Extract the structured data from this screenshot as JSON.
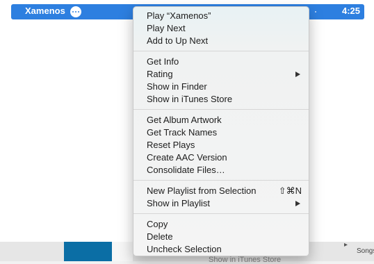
{
  "track": {
    "title": "Xamenos",
    "duration": "4:25"
  },
  "bottom": {
    "songs_label": "Songs",
    "faint_text": "Show in iTunes Store"
  },
  "menu": {
    "groups": [
      [
        {
          "label": "Play “Xamenos”"
        },
        {
          "label": "Play Next"
        },
        {
          "label": "Add to Up Next"
        }
      ],
      [
        {
          "label": "Get Info"
        },
        {
          "label": "Rating",
          "submenu": true
        },
        {
          "label": "Show in Finder"
        },
        {
          "label": "Show in iTunes Store"
        }
      ],
      [
        {
          "label": "Get Album Artwork"
        },
        {
          "label": "Get Track Names"
        },
        {
          "label": "Reset Plays"
        },
        {
          "label": "Create AAC Version"
        },
        {
          "label": "Consolidate Files…"
        }
      ],
      [
        {
          "label": "New Playlist from Selection",
          "shortcut": "⇧⌘N"
        },
        {
          "label": "Show in Playlist",
          "submenu": true
        }
      ],
      [
        {
          "label": "Copy"
        },
        {
          "label": "Delete"
        },
        {
          "label": "Uncheck Selection"
        }
      ]
    ]
  },
  "colors": {
    "selection": "#2d7fe0",
    "artwork": "#0b6ea5"
  }
}
